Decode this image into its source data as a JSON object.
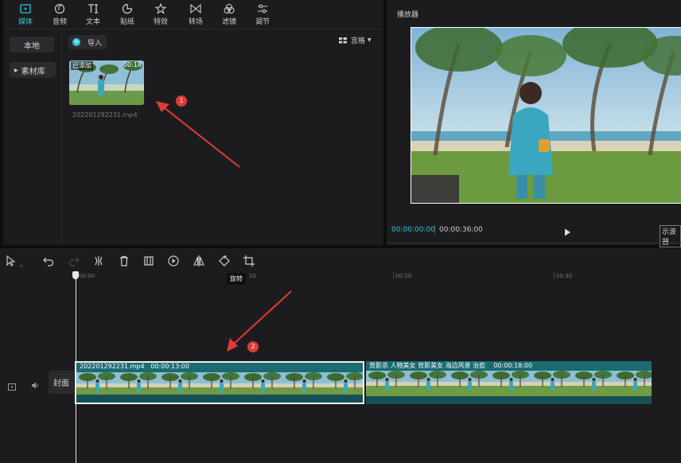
{
  "toolbar": {
    "tabs": [
      {
        "label": "媒体",
        "icon": "media-icon",
        "active": true
      },
      {
        "label": "音频",
        "icon": "audio-icon",
        "active": false
      },
      {
        "label": "文本",
        "icon": "text-icon",
        "active": false
      },
      {
        "label": "贴纸",
        "icon": "sticker-icon",
        "active": false
      },
      {
        "label": "特效",
        "icon": "effects-icon",
        "active": false
      },
      {
        "label": "转场",
        "icon": "transition-icon",
        "active": false
      },
      {
        "label": "滤镜",
        "icon": "filter-icon",
        "active": false
      },
      {
        "label": "调节",
        "icon": "adjust-icon",
        "active": false
      }
    ]
  },
  "sidebar": {
    "local": "本地",
    "library": "素材库"
  },
  "media": {
    "import_label": "导入",
    "view_label": "宫格",
    "item": {
      "badge": "已添加",
      "duration": "00:18",
      "filename": "202201292231.mp4"
    }
  },
  "player": {
    "title": "播放器",
    "current_time": "00:00:00:00",
    "total_time": "00:00:36:00",
    "waveform_label": "示波器"
  },
  "timeline": {
    "ruler_ticks": [
      "00:00",
      "10",
      "00:20",
      "00:30"
    ],
    "tooltip": "旋转",
    "cover_label": "封面",
    "clips": [
      {
        "name": "202201292231.mp4",
        "duration": "00:00:13:00"
      },
      {
        "name": "背影杀 人物美女 背影美女 海边风景 治愈",
        "duration": "00:00:18:00"
      }
    ]
  },
  "annotations": {
    "marker_1": "1",
    "marker_2": "2"
  },
  "colors": {
    "accent": "#2ec7d6",
    "clip": "#1b6b71",
    "arrow": "#e03b3b"
  }
}
